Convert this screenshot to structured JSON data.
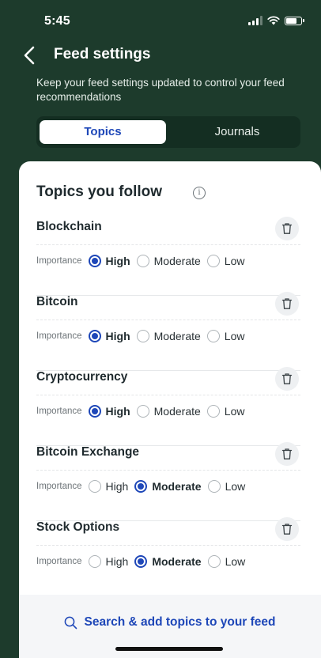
{
  "status_bar": {
    "time": "5:45"
  },
  "header": {
    "title": "Feed settings",
    "subtitle": "Keep your feed settings updated to control your feed recommendations"
  },
  "tabs": [
    {
      "label": "Topics",
      "active": true
    },
    {
      "label": "Journals",
      "active": false
    }
  ],
  "section": {
    "title": "Topics you follow",
    "info_icon": "info-icon"
  },
  "importance_label": "Importance",
  "options": [
    "High",
    "Moderate",
    "Low"
  ],
  "topics": [
    {
      "name": "Blockchain",
      "selected": "High"
    },
    {
      "name": "Bitcoin",
      "selected": "High"
    },
    {
      "name": "Cryptocurrency",
      "selected": "High"
    },
    {
      "name": "Bitcoin Exchange",
      "selected": "Moderate"
    },
    {
      "name": "Stock Options",
      "selected": "Moderate"
    }
  ],
  "search": {
    "label": "Search & add topics to your feed",
    "icon": "search-icon"
  },
  "colors": {
    "accent": "#1e47b8",
    "header_bg": "#1d3b2c",
    "sheet_bg": "#ffffff"
  }
}
